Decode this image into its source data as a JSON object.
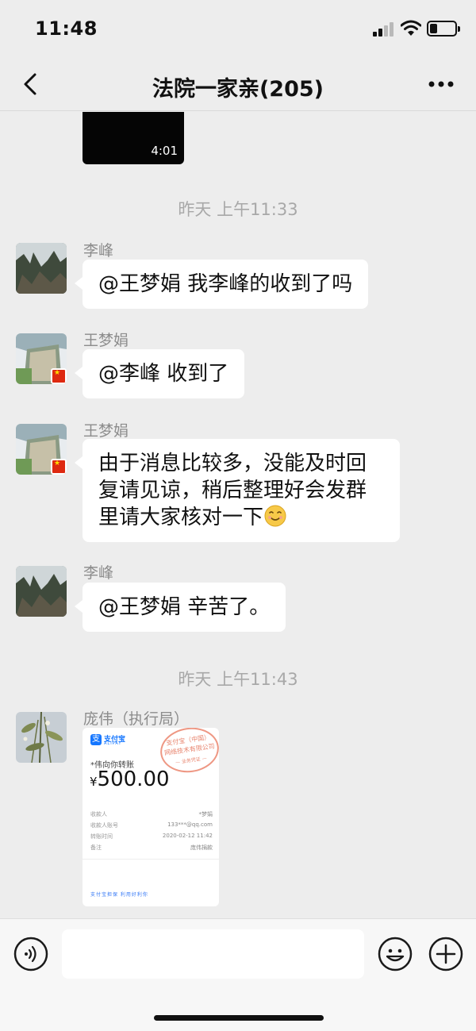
{
  "status_bar": {
    "time": "11:48"
  },
  "nav": {
    "title": "法院一家亲(205)"
  },
  "video": {
    "duration": "4:01"
  },
  "timestamps": [
    "昨天 上午11:33",
    "昨天 上午11:43"
  ],
  "messages": [
    {
      "sender": "李峰",
      "text": "@王梦娟 我李峰的收到了吗"
    },
    {
      "sender": "王梦娟",
      "text": "@李峰 收到了"
    },
    {
      "sender": "王梦娟",
      "text_line1": "由于消息比较多，没能及时回",
      "text_line2": "复请见谅，稍后整理好会发群",
      "text_line3": "里请大家核对一下"
    },
    {
      "sender": "李峰",
      "text": "@王梦娟 辛苦了。"
    },
    {
      "sender": "庞伟（执行局）"
    }
  ],
  "transfer": {
    "brand": "支付宝",
    "brand_sub": "ALIPAY",
    "desc": "*伟向你转账",
    "currency": "¥",
    "amount": "500.00",
    "rows": [
      {
        "label": "收款人",
        "value": "*梦娟"
      },
      {
        "label": "收款人账号",
        "value": "133***@qq.com"
      },
      {
        "label": "转账时间",
        "value": "2020-02-12 11:42"
      },
      {
        "label": "备注",
        "value": "庞伟捐款"
      }
    ],
    "stamp_line1": "支付宝（中国）",
    "stamp_line2": "网络技术有限公司",
    "stamp_line3": "— 业务凭证 —",
    "footer": "支付宝担保  利用好利你"
  },
  "input": {
    "placeholder": ""
  },
  "colors": {
    "background": "#ededed",
    "bubble": "#ffffff",
    "alipay_blue": "#1677ff",
    "stamp_red": "#e05a3c"
  }
}
